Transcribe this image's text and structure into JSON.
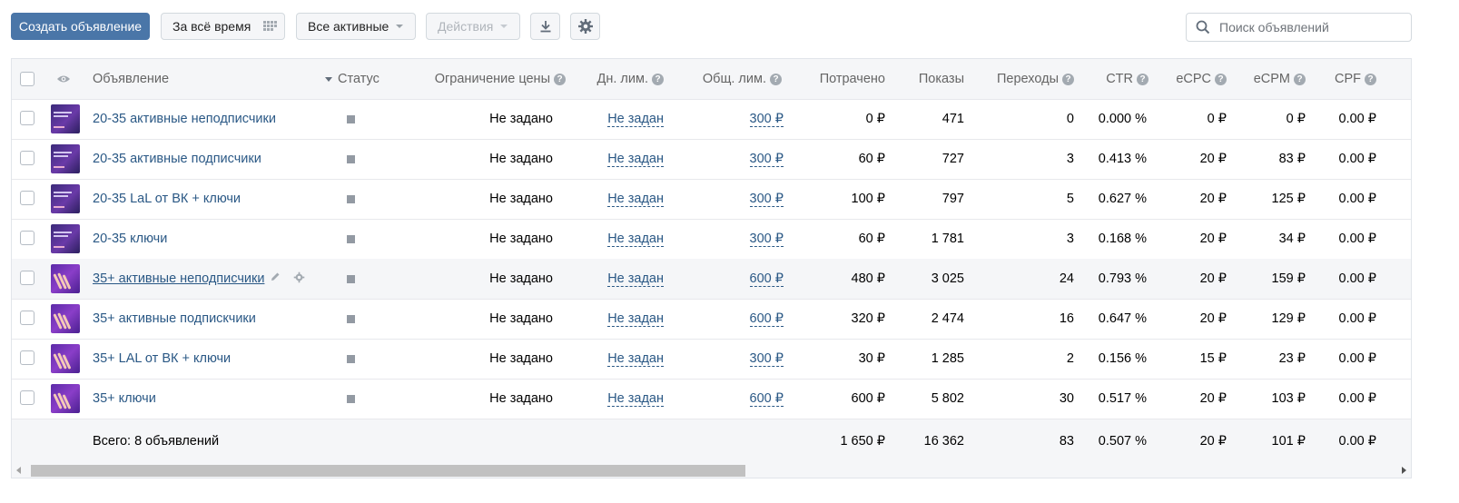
{
  "toolbar": {
    "create_label": "Создать объявление",
    "period_label": "За всё время",
    "filter_label": "Все активные",
    "actions_label": "Действия",
    "search_placeholder": "Поиск объявлений"
  },
  "table": {
    "headers": {
      "ad": "Объявление",
      "status": "Статус",
      "price_limit": "Ограничение цены",
      "day_limit": "Дн. лим.",
      "total_limit": "Общ. лим.",
      "spent": "Потрачено",
      "impressions": "Показы",
      "clicks": "Переходы",
      "ctr": "CTR",
      "ecpc": "eCPC",
      "ecpm": "eCPM",
      "cpf": "CPF"
    },
    "rows": [
      {
        "name": "20-35 активные неподписчики",
        "price_limit": "Не задано",
        "day_limit": "Не задан",
        "total_limit": "300 ₽",
        "spent": "0 ₽",
        "impressions": "471",
        "clicks": "0",
        "ctr": "0.000 %",
        "ecpc": "0 ₽",
        "ecpm": "0 ₽",
        "cpf": "0.00 ₽"
      },
      {
        "name": "20-35 активные подписчики",
        "price_limit": "Не задано",
        "day_limit": "Не задан",
        "total_limit": "300 ₽",
        "spent": "60 ₽",
        "impressions": "727",
        "clicks": "3",
        "ctr": "0.413 %",
        "ecpc": "20 ₽",
        "ecpm": "83 ₽",
        "cpf": "0.00 ₽"
      },
      {
        "name": "20-35 LaL от ВК + ключи",
        "price_limit": "Не задано",
        "day_limit": "Не задан",
        "total_limit": "300 ₽",
        "spent": "100 ₽",
        "impressions": "797",
        "clicks": "5",
        "ctr": "0.627 %",
        "ecpc": "20 ₽",
        "ecpm": "125 ₽",
        "cpf": "0.00 ₽"
      },
      {
        "name": "20-35 ключи",
        "price_limit": "Не задано",
        "day_limit": "Не задан",
        "total_limit": "300 ₽",
        "spent": "60 ₽",
        "impressions": "1 781",
        "clicks": "3",
        "ctr": "0.168 %",
        "ecpc": "20 ₽",
        "ecpm": "34 ₽",
        "cpf": "0.00 ₽"
      },
      {
        "name": "35+ активные неподписчики",
        "price_limit": "Не задано",
        "day_limit": "Не задан",
        "total_limit": "600 ₽",
        "spent": "480 ₽",
        "impressions": "3 025",
        "clicks": "24",
        "ctr": "0.793 %",
        "ecpc": "20 ₽",
        "ecpm": "159 ₽",
        "cpf": "0.00 ₽"
      },
      {
        "name": "35+ активные подпискчики",
        "price_limit": "Не задано",
        "day_limit": "Не задан",
        "total_limit": "600 ₽",
        "spent": "320 ₽",
        "impressions": "2 474",
        "clicks": "16",
        "ctr": "0.647 %",
        "ecpc": "20 ₽",
        "ecpm": "129 ₽",
        "cpf": "0.00 ₽"
      },
      {
        "name": "35+ LAL от ВК + ключи",
        "price_limit": "Не задано",
        "day_limit": "Не задан",
        "total_limit": "300 ₽",
        "spent": "30 ₽",
        "impressions": "1 285",
        "clicks": "2",
        "ctr": "0.156 %",
        "ecpc": "15 ₽",
        "ecpm": "23 ₽",
        "cpf": "0.00 ₽"
      },
      {
        "name": "35+ ключи",
        "price_limit": "Не задано",
        "day_limit": "Не задан",
        "total_limit": "600 ₽",
        "spent": "600 ₽",
        "impressions": "5 802",
        "clicks": "30",
        "ctr": "0.517 %",
        "ecpc": "20 ₽",
        "ecpm": "103 ₽",
        "cpf": "0.00 ₽"
      }
    ],
    "total": {
      "label": "Всего: 8 объявлений",
      "spent": "1 650 ₽",
      "impressions": "16 362",
      "clicks": "83",
      "ctr": "0.507 %",
      "ecpc": "20 ₽",
      "ecpm": "101 ₽",
      "cpf": "0.00 ₽"
    }
  },
  "colors": {
    "primary": "#4a76a8",
    "link": "#2a5885",
    "header_bg": "#f5f6f8",
    "thumb_purple": "#6a3aa8"
  },
  "icons": {
    "period": "grid-icon",
    "download": "download-icon",
    "settings": "gear-icon",
    "search": "search-icon",
    "visibility": "eye-icon",
    "help": "question-icon",
    "edit": "pencil-icon"
  }
}
